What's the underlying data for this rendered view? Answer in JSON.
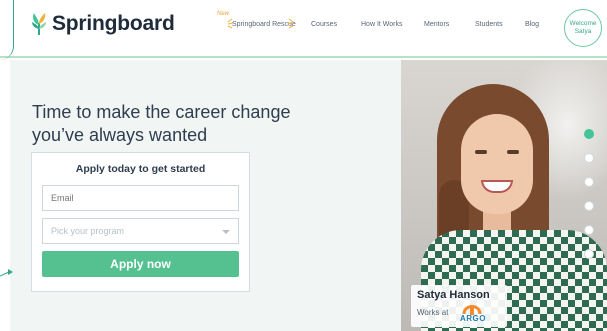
{
  "brand": {
    "name": "Springboard",
    "logo_icon": "springboard-leaf-icon",
    "accent": "#55c191"
  },
  "nav": {
    "new_badge": "New",
    "items": [
      "Springboard Rescue",
      "Courses",
      "How It Works",
      "Mentors",
      "Students",
      "Blog"
    ]
  },
  "welcome": {
    "line1": "Welcome",
    "line2": "Satya"
  },
  "hero": {
    "title": "Time to make the career change you’ve always wanted"
  },
  "form": {
    "title": "Apply today to get started",
    "email_placeholder": "Email",
    "program_placeholder": "Pick your program",
    "submit_label": "Apply now"
  },
  "testimonial": {
    "name": "Satya Hanson",
    "works_at": "Works at",
    "company": "ARGO"
  },
  "carousel": {
    "slide_count": 6,
    "active_index": 0
  }
}
